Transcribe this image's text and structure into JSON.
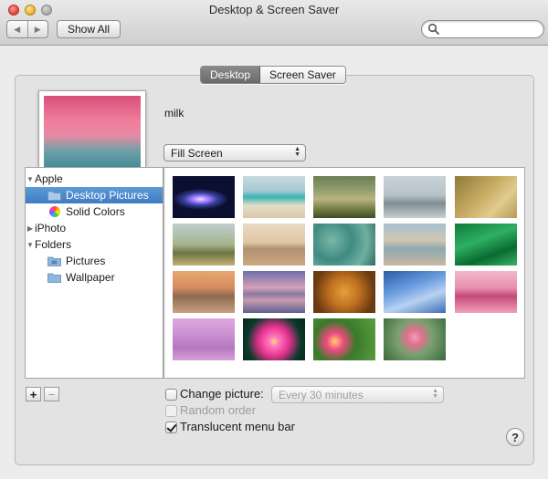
{
  "window": {
    "title": "Desktop & Screen Saver"
  },
  "toolbar": {
    "back_label": "◀",
    "forward_label": "▶",
    "show_all_label": "Show All"
  },
  "tabs": [
    {
      "label": "Desktop",
      "selected": true
    },
    {
      "label": "Screen Saver",
      "selected": false
    }
  ],
  "preview": {
    "picture_name": "milk"
  },
  "fit_select": {
    "value": "Fill Screen"
  },
  "sources": [
    {
      "label": "Apple",
      "type": "group",
      "expanded": true
    },
    {
      "label": "Desktop Pictures",
      "type": "folder",
      "selected": true
    },
    {
      "label": "Solid Colors",
      "type": "colors"
    },
    {
      "label": "iPhoto",
      "type": "group",
      "expanded": false
    },
    {
      "label": "Folders",
      "type": "group",
      "expanded": true
    },
    {
      "label": "Pictures",
      "type": "folder"
    },
    {
      "label": "Wallpaper",
      "type": "folder"
    }
  ],
  "thumbnails": [
    "galaxy",
    "beach",
    "grass",
    "lake-mist",
    "golden-field",
    "elephant",
    "zebras",
    "lily-pads",
    "shore",
    "green-waves",
    "sunset-island",
    "mountain-lake",
    "lion",
    "clouds-moon",
    "pink-mountain",
    "pink-mist",
    "lotus",
    "pink-flowers",
    "blossoms"
  ],
  "list_buttons": {
    "add_label": "+",
    "remove_label": "−"
  },
  "options": {
    "change_picture_label": "Change picture:",
    "change_picture_checked": false,
    "interval_value": "Every 30 minutes",
    "random_order_label": "Random order",
    "translucent_label": "Translucent menu bar",
    "translucent_checked": true
  },
  "help_label": "?"
}
